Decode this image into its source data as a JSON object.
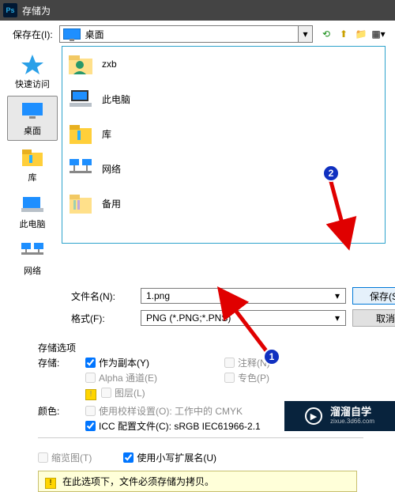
{
  "window": {
    "title": "存储为",
    "app_icon": "Ps"
  },
  "location": {
    "label": "保存在(I):",
    "value_icon": "monitor",
    "value": "桌面"
  },
  "toolbar_icons": [
    "back-icon",
    "up-icon",
    "new-folder-icon",
    "view-menu-icon"
  ],
  "places": [
    {
      "id": "quick-access",
      "label": "快速访问"
    },
    {
      "id": "desktop",
      "label": "桌面",
      "selected": true
    },
    {
      "id": "libraries",
      "label": "库"
    },
    {
      "id": "this-pc",
      "label": "此电脑"
    },
    {
      "id": "network",
      "label": "网络"
    }
  ],
  "items": [
    {
      "icon": "user-folder",
      "label": "zxb"
    },
    {
      "icon": "this-pc",
      "label": "此电脑"
    },
    {
      "icon": "library-folder",
      "label": "库"
    },
    {
      "icon": "network",
      "label": "网络"
    },
    {
      "icon": "folder",
      "label": "备用"
    }
  ],
  "filename_label": "文件名(N):",
  "filename_value": "1.png",
  "format_label": "格式(F):",
  "format_value": "PNG (*.PNG;*.PNS)",
  "btn_save": "保存(S)",
  "btn_cancel": "取消",
  "opts": {
    "section": "存储选项",
    "store": "存储:",
    "copy": "作为副本(Y)",
    "notes": "注释(N)",
    "alpha": "Alpha 通道(E)",
    "spot": "专色(P)",
    "layers": "图层(L)",
    "color_section": "颜色:",
    "proof": "使用校样设置(O): 工作中的 CMYK",
    "icc": "ICC 配置文件(C): sRGB IEC61966-2.1"
  },
  "thumb": "缩览图(T)",
  "lower_ext": "使用小写扩展名(U)",
  "notice": "在此选项下，文件必须存储为拷贝。",
  "watermark": {
    "brand": "溜溜自学",
    "url": "zixue.3d66.com"
  },
  "annotations": {
    "badge1": "1",
    "badge2": "2"
  }
}
